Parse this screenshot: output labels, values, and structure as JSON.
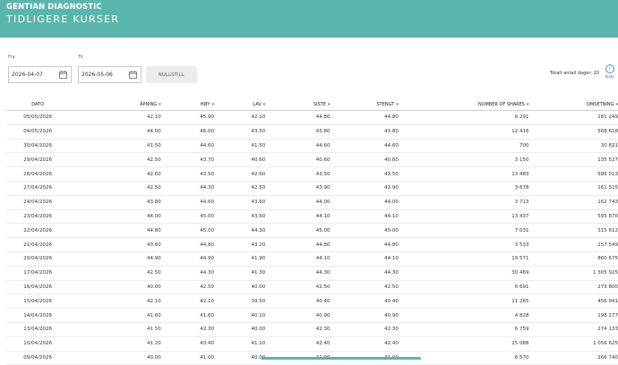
{
  "header": {
    "brand": "GENTIAN DIAGNOSTIC",
    "title": "TIDLIGERE KURSER"
  },
  "filters": {
    "from_label": "Fra",
    "to_label": "Til",
    "from_value": "2026-04-07",
    "to_value": "2026-05-06",
    "reset_label": "NULLSTILL"
  },
  "total_days": "Totalt antall dager: 20",
  "help_label": "Hjelp",
  "colors": {
    "header_bg": "#5ab5ad",
    "sort_icon": "#3a6fa0"
  },
  "table": {
    "headers": [
      "DATO",
      "ÅPNING",
      "HØY",
      "LAV",
      "SISTE",
      "STENGT",
      "NUMBER OF SHARES",
      "OMSETNING"
    ],
    "rows": [
      [
        "05/05/2026",
        "42.10",
        "45.90",
        "42.10",
        "44.80",
        "44.80",
        "6 291",
        "281 249"
      ],
      [
        "04/05/2026",
        "44.00",
        "46.00",
        "43.50",
        "43.80",
        "43.80",
        "12 416",
        "568 618"
      ],
      [
        "30/04/2026",
        "41.50",
        "44.60",
        "41.50",
        "44.60",
        "44.60",
        "700",
        "30 821"
      ],
      [
        "29/04/2026",
        "42.50",
        "43.70",
        "40.60",
        "40.60",
        "40.60",
        "3 150",
        "135 527"
      ],
      [
        "28/04/2026",
        "42.60",
        "43.50",
        "42.60",
        "43.50",
        "43.50",
        "13 483",
        "586 013"
      ],
      [
        "27/04/2026",
        "42.50",
        "44.30",
        "42.50",
        "43.90",
        "43.90",
        "3 678",
        "161 515"
      ],
      [
        "24/04/2026",
        "43.80",
        "44.00",
        "43.60",
        "44.00",
        "44.00",
        "3 713",
        "162 743"
      ],
      [
        "23/04/2026",
        "44.00",
        "45.00",
        "43.60",
        "44.10",
        "44.10",
        "13 437",
        "595 870"
      ],
      [
        "22/04/2026",
        "44.80",
        "45.00",
        "44.30",
        "45.00",
        "45.00",
        "7 031",
        "315 612"
      ],
      [
        "21/04/2026",
        "43.60",
        "44.80",
        "43.20",
        "44.80",
        "44.80",
        "3 533",
        "157 549"
      ],
      [
        "20/04/2026",
        "44.90",
        "44.90",
        "41.90",
        "44.10",
        "44.10",
        "19 571",
        "860 675"
      ],
      [
        "17/04/2026",
        "42.50",
        "44.30",
        "41.30",
        "44.30",
        "44.30",
        "30 469",
        "1 305 925"
      ],
      [
        "16/04/2026",
        "40.00",
        "42.50",
        "40.00",
        "42.50",
        "42.50",
        "6 691",
        "273 800"
      ],
      [
        "15/04/2026",
        "42.10",
        "42.10",
        "39.50",
        "40.40",
        "40.40",
        "11 265",
        "456 041"
      ],
      [
        "14/04/2026",
        "41.60",
        "41.60",
        "40.10",
        "40.90",
        "40.90",
        "4 828",
        "198 277"
      ],
      [
        "13/04/2026",
        "41.50",
        "42.30",
        "40.00",
        "42.30",
        "42.30",
        "6 759",
        "274 133"
      ],
      [
        "10/04/2026",
        "41.20",
        "43.40",
        "41.10",
        "42.40",
        "42.40",
        "25 088",
        "1 056 625"
      ],
      [
        "09/04/2026",
        "40.00",
        "41.00",
        "40.00",
        "41.00",
        "41.00",
        "6 570",
        "266 740"
      ]
    ]
  }
}
